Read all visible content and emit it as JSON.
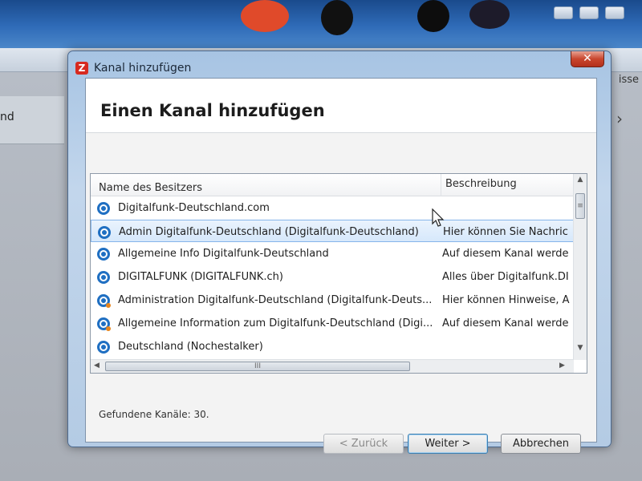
{
  "dialog": {
    "title": "Kanal hinzufügen",
    "close_glyph": "✕",
    "app_icon_letter": "Z",
    "header_title": "Einen Kanal hinzufügen"
  },
  "background": {
    "left_label": "nd",
    "right_label": "isse",
    "right_chevron": "›"
  },
  "list": {
    "columns": [
      "Name des Besitzers",
      "Beschreibung"
    ],
    "rows": [
      {
        "name": "Digitalfunk-Deutschland.com",
        "description": "",
        "icon": "channel-icon"
      },
      {
        "name": "Admin Digitalfunk-Deutschland (Digitalfunk-Deutschland)",
        "description": "Hier können Sie Nachric",
        "icon": "channel-icon"
      },
      {
        "name": "Allgemeine Info Digitalfunk-Deutschland",
        "description": "Auf diesem Kanal werde",
        "icon": "channel-icon"
      },
      {
        "name": "DIGITALFUNK (DIGITALFUNK.ch)",
        "description": "Alles über Digitalfunk.DI",
        "icon": "channel-icon"
      },
      {
        "name": "Administration Digitalfunk-Deutschland (Digitalfunk-Deuts...",
        "description": "Hier können Hinweise, A",
        "icon": "channel-user-icon"
      },
      {
        "name": "Allgemeine Information zum Digitalfunk-Deutschland (Digi...",
        "description": "Auf diesem Kanal werde",
        "icon": "channel-user-icon"
      },
      {
        "name": "Deutschland (Nochestalker)",
        "description": "",
        "icon": "channel-icon"
      }
    ],
    "selected_index": 1,
    "hscroll_grip": "III",
    "vscroll_grip": "≡"
  },
  "status": {
    "found_text": "Gefundene Kanäle: 30."
  },
  "buttons": {
    "back": "< Zurück",
    "next": "Weiter >",
    "cancel": "Abbrechen"
  }
}
